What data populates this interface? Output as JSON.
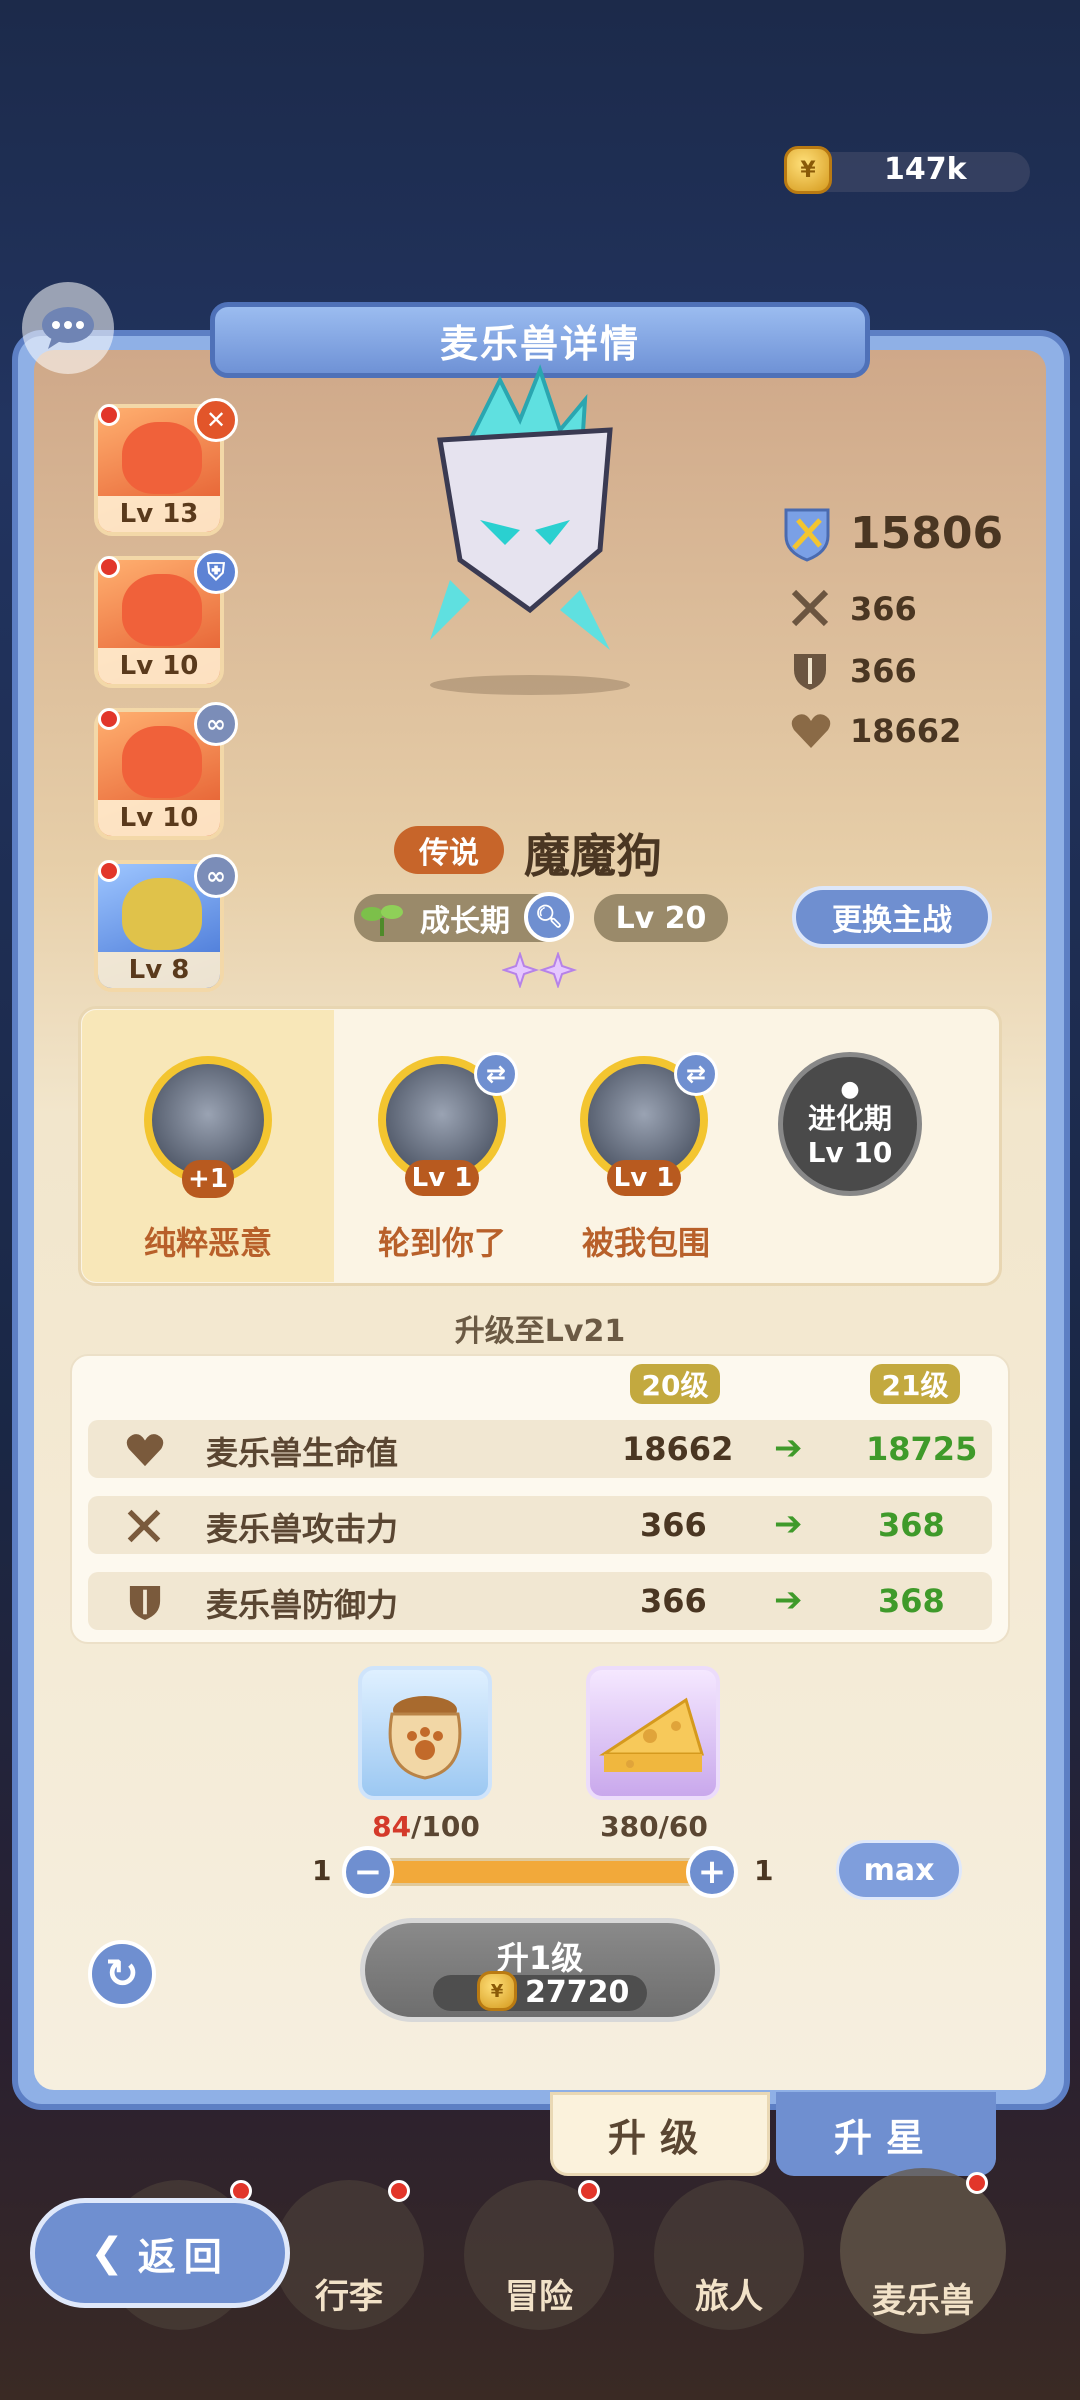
{
  "currency": {
    "amount": "147k",
    "icon": "gold-coin-icon"
  },
  "panel": {
    "title": "麦乐兽详情"
  },
  "pet_list": [
    {
      "level": "Lv 13",
      "badge_icon": "close-icon",
      "color": "#e2552a"
    },
    {
      "level": "Lv 10",
      "badge_icon": "shield-icon",
      "color": "#e2552a"
    },
    {
      "level": "Lv 10",
      "badge_icon": "link-icon",
      "color": "#e2552a"
    },
    {
      "level": "Lv 8",
      "badge_icon": "link-icon",
      "color": "#3f6fd2"
    }
  ],
  "stats": {
    "power": "15806",
    "attack": "366",
    "defense": "366",
    "hp": "18662"
  },
  "pet": {
    "rarity": "传说",
    "name": "魔魔狗",
    "stage": "成长期",
    "level": "Lv 20",
    "swap_label": "更换主战"
  },
  "skills": [
    {
      "name": "纯粹恶意",
      "badge": "+1",
      "selected": true
    },
    {
      "name": "轮到你了",
      "level": "Lv 1"
    },
    {
      "name": "被我包围",
      "level": "Lv 1"
    },
    {
      "locked_line1": "进化期",
      "locked_line2": "Lv 10"
    }
  ],
  "upgrade": {
    "title": "升级至Lv21",
    "from_level": "20级",
    "to_level": "21级",
    "rows": [
      {
        "label": "麦乐兽生命值",
        "old": "18662",
        "new": "18725",
        "icon": "heart-icon"
      },
      {
        "label": "麦乐兽攻击力",
        "old": "366",
        "new": "368",
        "icon": "swords-icon"
      },
      {
        "label": "麦乐兽防御力",
        "old": "366",
        "new": "368",
        "icon": "shield-icon"
      }
    ],
    "materials": [
      {
        "name": "food-bag",
        "have": "84",
        "need": "/100"
      },
      {
        "name": "cheese",
        "count": "380/60"
      }
    ],
    "slider": {
      "min": "1",
      "max": "1",
      "max_label": "max"
    },
    "button_label": "升1级",
    "cost": "27720"
  },
  "tabs": {
    "upgrade": "升级",
    "star": "升星"
  },
  "nav": {
    "back": "返回",
    "items": [
      "行李",
      "冒险",
      "旅人",
      "麦乐兽"
    ]
  },
  "colors": {
    "accent_blue": "#6f8fd0",
    "gain_green": "#3f9a2a",
    "rarity_orange": "#c7652a"
  }
}
